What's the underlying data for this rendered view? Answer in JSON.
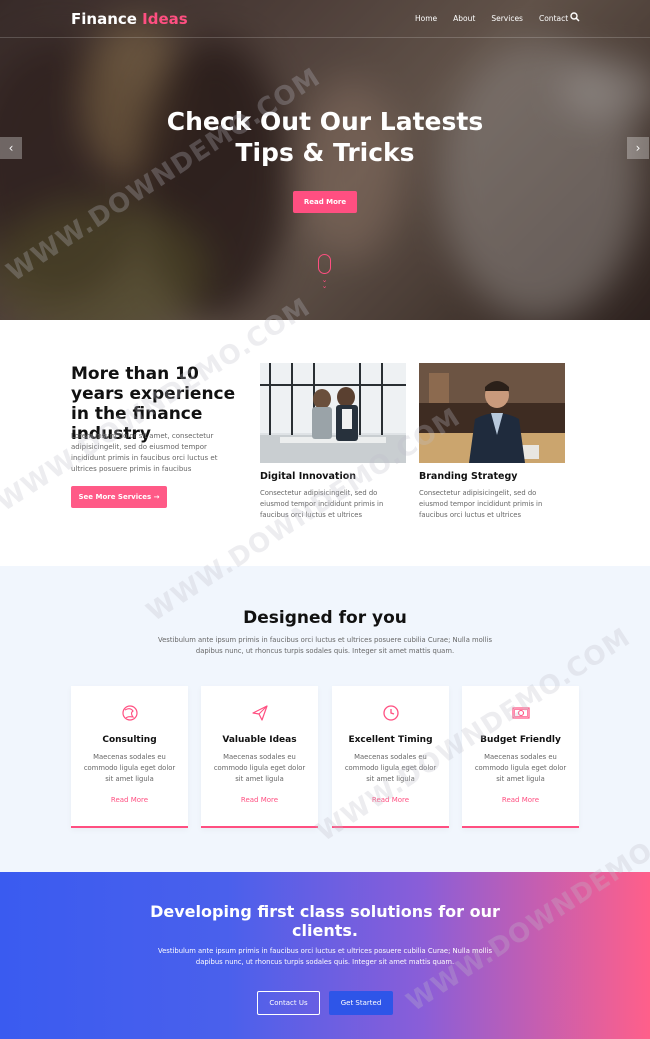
{
  "header": {
    "logo_primary": "Finance",
    "logo_accent": "Ideas",
    "nav": [
      "Home",
      "About",
      "Services",
      "Contact"
    ],
    "search_icon": "search-icon"
  },
  "hero": {
    "title_line1": "Check Out Our Latests",
    "title_line2": "Tips & Tricks",
    "button": "Read More",
    "prev_icon": "chevron-left-icon",
    "next_icon": "chevron-right-icon"
  },
  "experience": {
    "title": "More than 10 years experience in the finance industry",
    "text": "Lorem ipsum dolor sit amet, consectetur adipisicingelit, sed do eiusmod tempor incididunt primis in faucibus orci luctus et ultrices posuere primis in faucibus",
    "button": "See More Services →",
    "cards": [
      {
        "title": "Digital Innovation",
        "text": "Consectetur adipisicingelit, sed do eiusmod tempor incididunt primis in faucibus orci luctus et ultrices"
      },
      {
        "title": "Branding Strategy",
        "text": "Consectetur adipisicingelit, sed do eiusmod tempor incididunt primis in faucibus orci luctus et ultrices"
      }
    ]
  },
  "designed": {
    "title": "Designed for you",
    "subtitle": "Vestibulum ante ipsum primis in faucibus orci luctus et ultrices posuere cubilia Curae; Nulla mollis dapibus nunc, ut rhoncus turpis sodales quis. Integer sit amet mattis quam.",
    "services": [
      {
        "title": "Consulting",
        "text": "Maecenas sodales eu commodo ligula eget dolor sit amet ligula",
        "more": "Read More",
        "icon": "globe-icon"
      },
      {
        "title": "Valuable Ideas",
        "text": "Maecenas sodales eu commodo ligula eget dolor sit amet ligula",
        "more": "Read More",
        "icon": "paper-plane-icon"
      },
      {
        "title": "Excellent Timing",
        "text": "Maecenas sodales eu commodo ligula eget dolor sit amet ligula",
        "more": "Read More",
        "icon": "clock-icon"
      },
      {
        "title": "Budget Friendly",
        "text": "Maecenas sodales eu commodo ligula eget dolor sit amet ligula",
        "more": "Read More",
        "icon": "money-icon"
      }
    ]
  },
  "cta": {
    "title": "Developing first class solutions for our clients.",
    "subtitle": "Vestibulum ante ipsum primis in faucibus orci luctus et ultrices posuere cubilia Curae; Nulla mollis dapibus nunc, ut rhoncus turpis sodales quis. Integer sit amet mattis quam.",
    "button_contact": "Contact Us",
    "button_started": "Get Started"
  },
  "watermark": "WWW.DOWNDEMO.COM",
  "colors": {
    "accent": "#ff4f81",
    "primary_blue": "#2e55e8"
  }
}
